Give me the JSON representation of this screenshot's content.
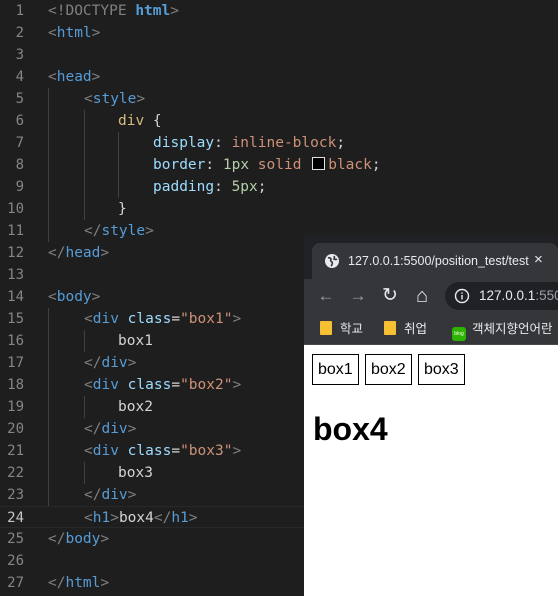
{
  "editor": {
    "line_numbers": [
      "1",
      "2",
      "3",
      "4",
      "5",
      "6",
      "7",
      "8",
      "9",
      "10",
      "11",
      "12",
      "13",
      "14",
      "15",
      "16",
      "17",
      "18",
      "19",
      "20",
      "21",
      "22",
      "23",
      "24",
      "25",
      "26",
      "27"
    ],
    "current_line": "24",
    "l1": {
      "a": "<!DOCTYPE ",
      "b": "html",
      "c": ">"
    },
    "l2": {
      "a": "<",
      "b": "html",
      "c": ">"
    },
    "l4": {
      "a": "<",
      "b": "head",
      "c": ">"
    },
    "l5": {
      "a": "<",
      "b": "style",
      "c": ">"
    },
    "l6": {
      "a": "div",
      "b": " {"
    },
    "l7": {
      "a": "display",
      "b": ": ",
      "c": "inline-block",
      "d": ";"
    },
    "l8": {
      "a": "border",
      "b": ": ",
      "c": "1px",
      "d": " ",
      "e": "solid",
      "f": "black",
      "g": ";"
    },
    "l9": {
      "a": "padding",
      "b": ": ",
      "c": "5px",
      "d": ";"
    },
    "l10": {
      "a": "}"
    },
    "l11": {
      "a": "</",
      "b": "style",
      "c": ">"
    },
    "l12": {
      "a": "</",
      "b": "head",
      "c": ">"
    },
    "l14": {
      "a": "<",
      "b": "body",
      "c": ">"
    },
    "l15": {
      "a": "<",
      "b": "div",
      "c": " class",
      "d": "=",
      "e": "\"box1\"",
      "f": ">"
    },
    "l16": {
      "a": "box1"
    },
    "l17": {
      "a": "</",
      "b": "div",
      "c": ">"
    },
    "l18": {
      "a": "<",
      "b": "div",
      "c": " class",
      "d": "=",
      "e": "\"box2\"",
      "f": ">"
    },
    "l19": {
      "a": "box2"
    },
    "l20": {
      "a": "</",
      "b": "div",
      "c": ">"
    },
    "l21": {
      "a": "<",
      "b": "div",
      "c": " class",
      "d": "=",
      "e": "\"box3\"",
      "f": ">"
    },
    "l22": {
      "a": "box3"
    },
    "l23": {
      "a": "</",
      "b": "div",
      "c": ">"
    },
    "l24": {
      "a": "<",
      "b": "h1",
      "c": ">",
      "d": "box4",
      "e": "</",
      "f": "h1",
      "g": ">"
    },
    "l25": {
      "a": "</",
      "b": "body",
      "c": ">"
    },
    "l27": {
      "a": "</",
      "b": "html",
      "c": ">"
    }
  },
  "browser": {
    "tab_title": "127.0.0.1:5500/position_test/test",
    "tab_close": "×",
    "url_main": "127.0.0.1",
    "url_port": ":550",
    "nav": {
      "back": "←",
      "forward": "→",
      "reload": "↻",
      "home": "⌂"
    },
    "bookmarks": [
      {
        "label": "학교"
      },
      {
        "label": "취업"
      },
      {
        "label": "객체지향언어란",
        "badge": "blog"
      }
    ],
    "page": {
      "boxes": [
        "box1",
        "box2",
        "box3"
      ],
      "heading": "box4"
    }
  },
  "colors": {
    "editor_bg": "#1e1e1e",
    "tag": "#569cd6",
    "attribute": "#9cdcfe",
    "string": "#ce9178",
    "selector": "#d7ba7d",
    "number": "#b5cea8",
    "browser_chrome": "#35363a"
  }
}
